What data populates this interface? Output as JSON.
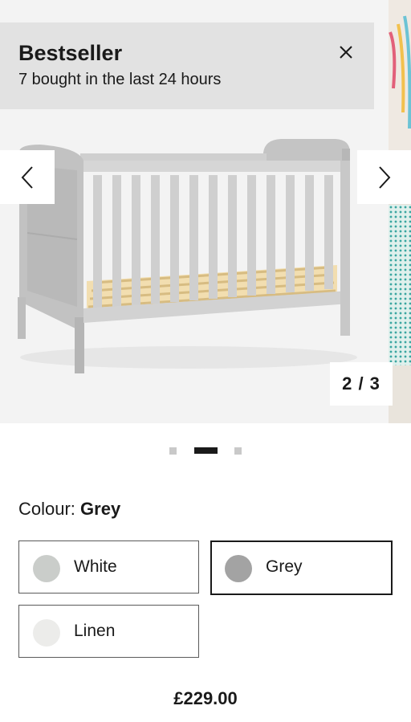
{
  "banner": {
    "title": "Bestseller",
    "subtitle": "7 bought in the last 24 hours"
  },
  "gallery": {
    "counter": "2 / 3",
    "current_slide": 2,
    "total_slides": 3,
    "image_alt": "Grey cot bed"
  },
  "colour": {
    "label": "Colour:",
    "selected": "Grey",
    "options": [
      {
        "name": "White",
        "swatch": "#cacdca",
        "selected": false
      },
      {
        "name": "Grey",
        "swatch": "#a3a3a3",
        "selected": true
      },
      {
        "name": "Linen",
        "swatch": "#ececea",
        "selected": false
      }
    ]
  },
  "price": "£229.00",
  "colors": {
    "accent": "#1a1a1a",
    "banner_bg": "#e2e2e2",
    "image_bg": "#f3f3f3"
  },
  "icons": {
    "close": "close-icon",
    "prev": "chevron-left-icon",
    "next": "chevron-right-icon"
  }
}
